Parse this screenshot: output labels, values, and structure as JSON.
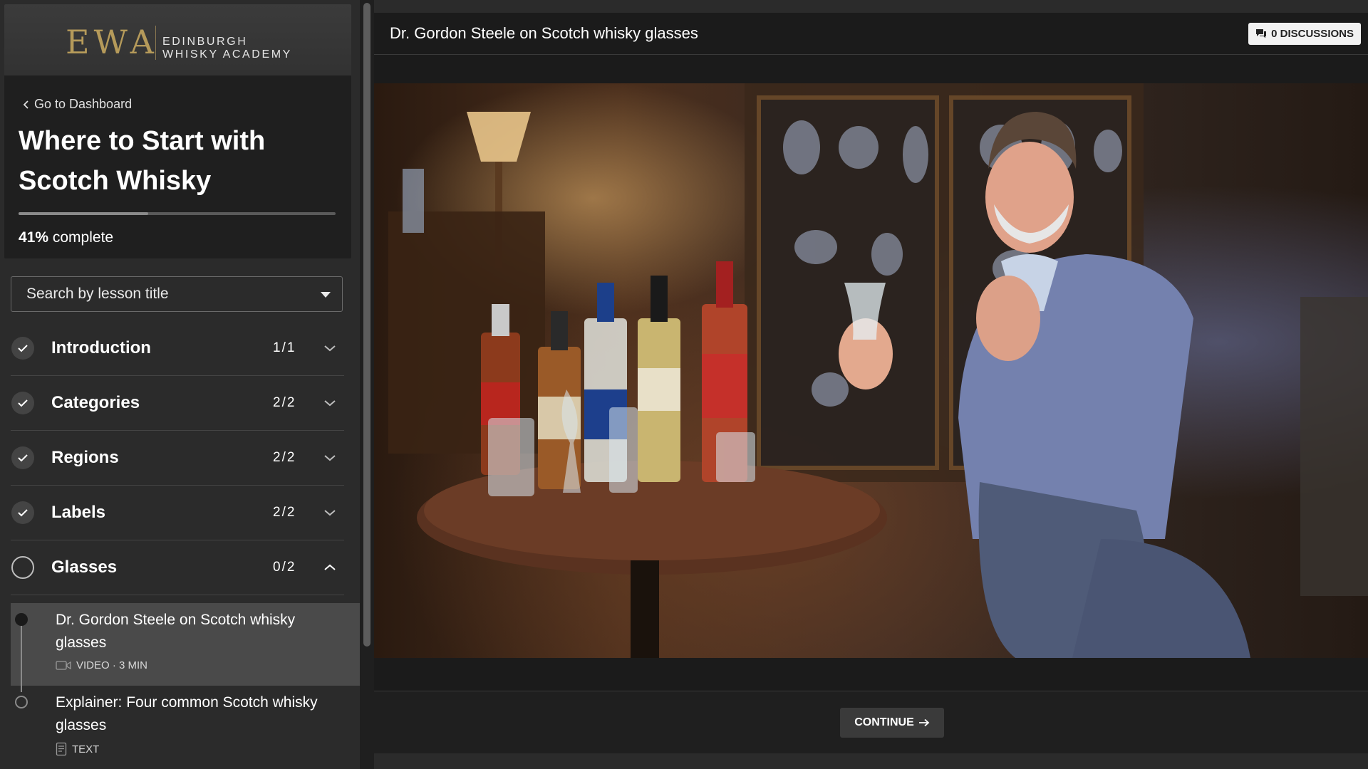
{
  "brand": {
    "logo_mark": "EWA",
    "name_line1": "EDINBURGH",
    "name_line2": "WHISKY ACADEMY"
  },
  "sidebar": {
    "back_label": "Go to Dashboard",
    "course_title": "Where to Start with Scotch Whisky",
    "progress_percent": 41,
    "progress_value": "41%",
    "progress_suffix": "complete",
    "search_placeholder": "Search by lesson title",
    "sections": [
      {
        "title": "Introduction",
        "count": "1/1",
        "completed": true,
        "expanded": false
      },
      {
        "title": "Categories",
        "count": "2/2",
        "completed": true,
        "expanded": false
      },
      {
        "title": "Regions",
        "count": "2/2",
        "completed": true,
        "expanded": false
      },
      {
        "title": "Labels",
        "count": "2/2",
        "completed": true,
        "expanded": false
      },
      {
        "title": "Glasses",
        "count": "0/2",
        "completed": false,
        "expanded": true
      }
    ],
    "lessons": [
      {
        "title": "Dr. Gordon Steele on Scotch whisky glasses",
        "meta": "VIDEO · 3 MIN",
        "icon": "video-camera-icon",
        "active": true
      },
      {
        "title": "Explainer: Four common Scotch whisky glasses",
        "meta": "TEXT",
        "icon": "document-icon",
        "active": false
      }
    ]
  },
  "main": {
    "lesson_title": "Dr. Gordon Steele on Scotch whisky glasses",
    "discussions_label": "0 DISCUSSIONS",
    "continue_label": "CONTINUE"
  },
  "colors": {
    "sidebar_bg": "#2b2b2b",
    "card_bg": "#1f1f1f",
    "logo_gold": "#b59a5a",
    "main_bg": "#1b1b1b",
    "active_lesson_bg": "#4a4a4a"
  }
}
